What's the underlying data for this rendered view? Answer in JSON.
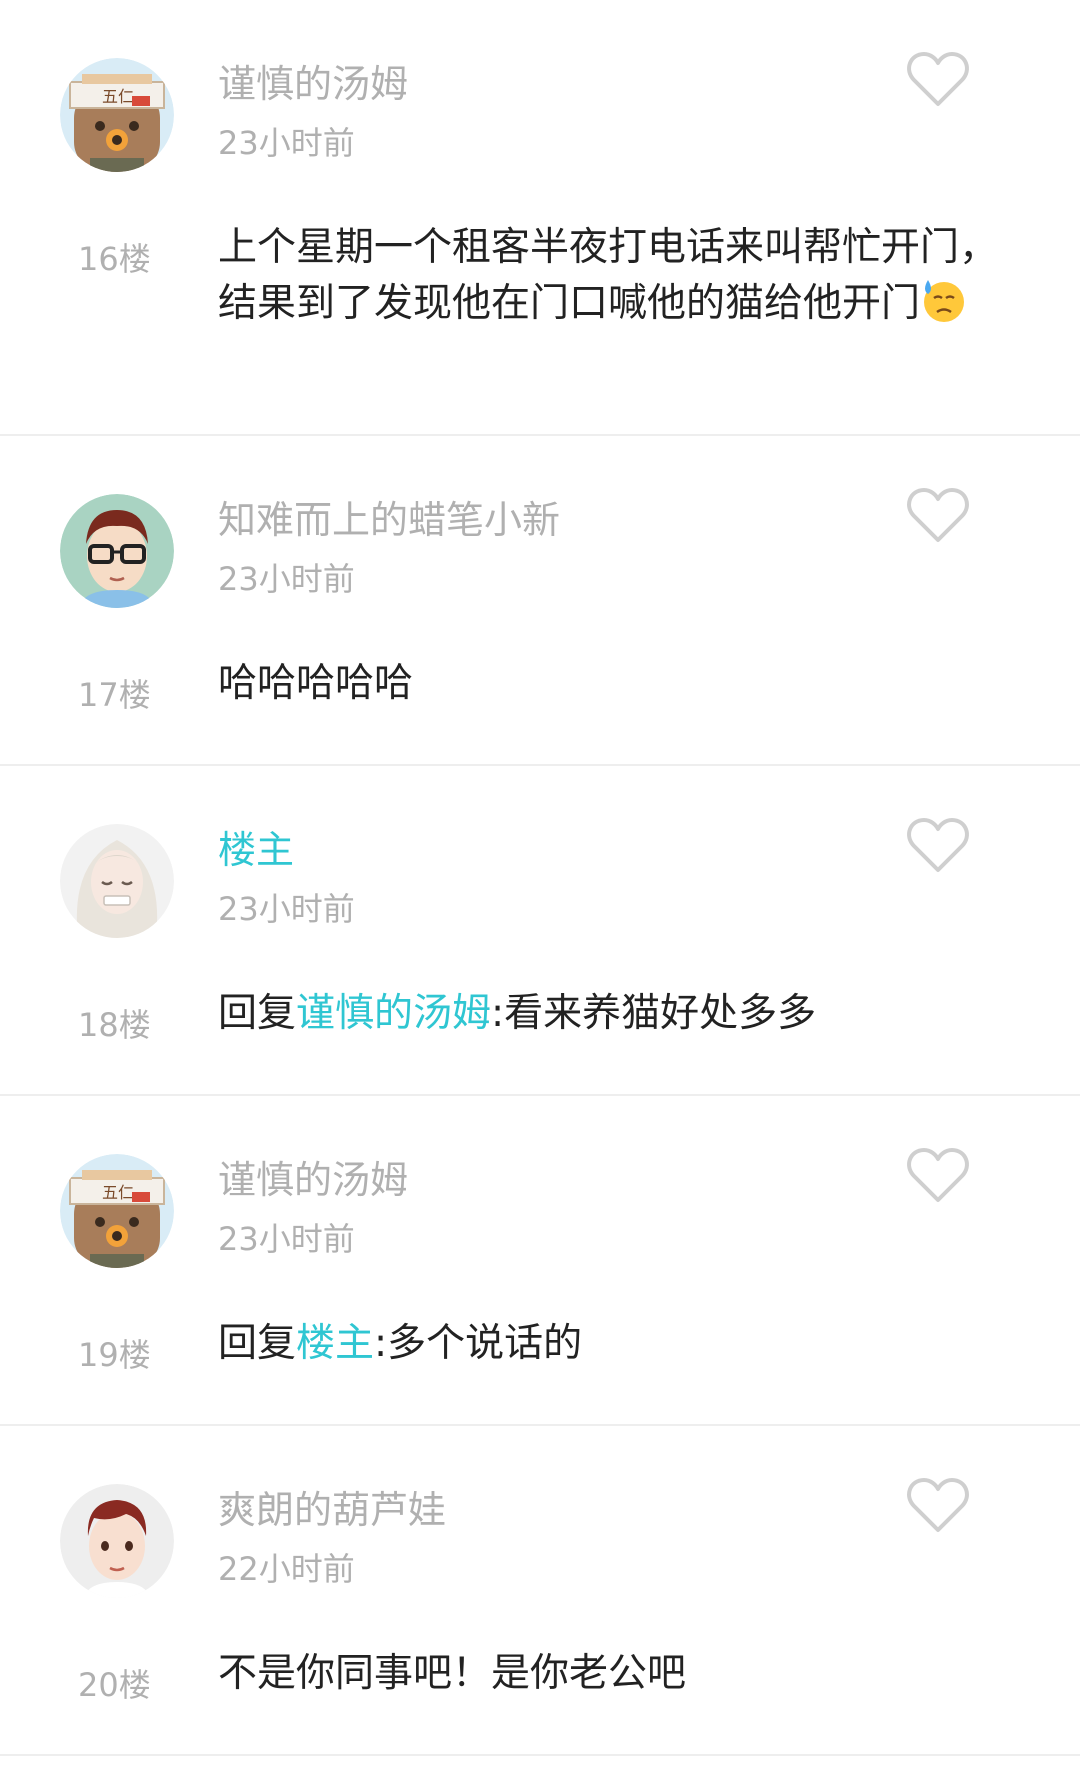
{
  "colors": {
    "accent": "#2fc6d2",
    "muted": "#b0b0b0",
    "text": "#222222",
    "divider": "#eeeeee"
  },
  "comments": [
    {
      "username": "谨慎的汤姆",
      "time": "23小时前",
      "floor": "16楼",
      "avatar_icon": "bear-avatar",
      "like_icon": "heart-outline-icon",
      "content": "上个星期一个租客半夜打电话来叫帮忙开门，结果到了发现他在门口喊他的猫给他开门",
      "emoji": "sweat-emoji-icon"
    },
    {
      "username": "知难而上的蜡笔小新",
      "time": "23小时前",
      "floor": "17楼",
      "avatar_icon": "glasses-boy-avatar",
      "like_icon": "heart-outline-icon",
      "content": "哈哈哈哈哈"
    },
    {
      "username": "楼主",
      "time": "23小时前",
      "floor": "18楼",
      "avatar_icon": "white-hair-girl-avatar",
      "like_icon": "heart-outline-icon",
      "reply_prefix": "回复",
      "reply_to": "谨慎的汤姆",
      "content": ":看来养猫好处多多"
    },
    {
      "username": "谨慎的汤姆",
      "time": "23小时前",
      "floor": "19楼",
      "avatar_icon": "bear-avatar",
      "like_icon": "heart-outline-icon",
      "reply_prefix": "回复",
      "reply_to": "楼主",
      "content": ":多个说话的"
    },
    {
      "username": "爽朗的葫芦娃",
      "time": "22小时前",
      "floor": "20楼",
      "avatar_icon": "boy-avatar",
      "like_icon": "heart-outline-icon",
      "content": "不是你同事吧！是你老公吧"
    }
  ]
}
